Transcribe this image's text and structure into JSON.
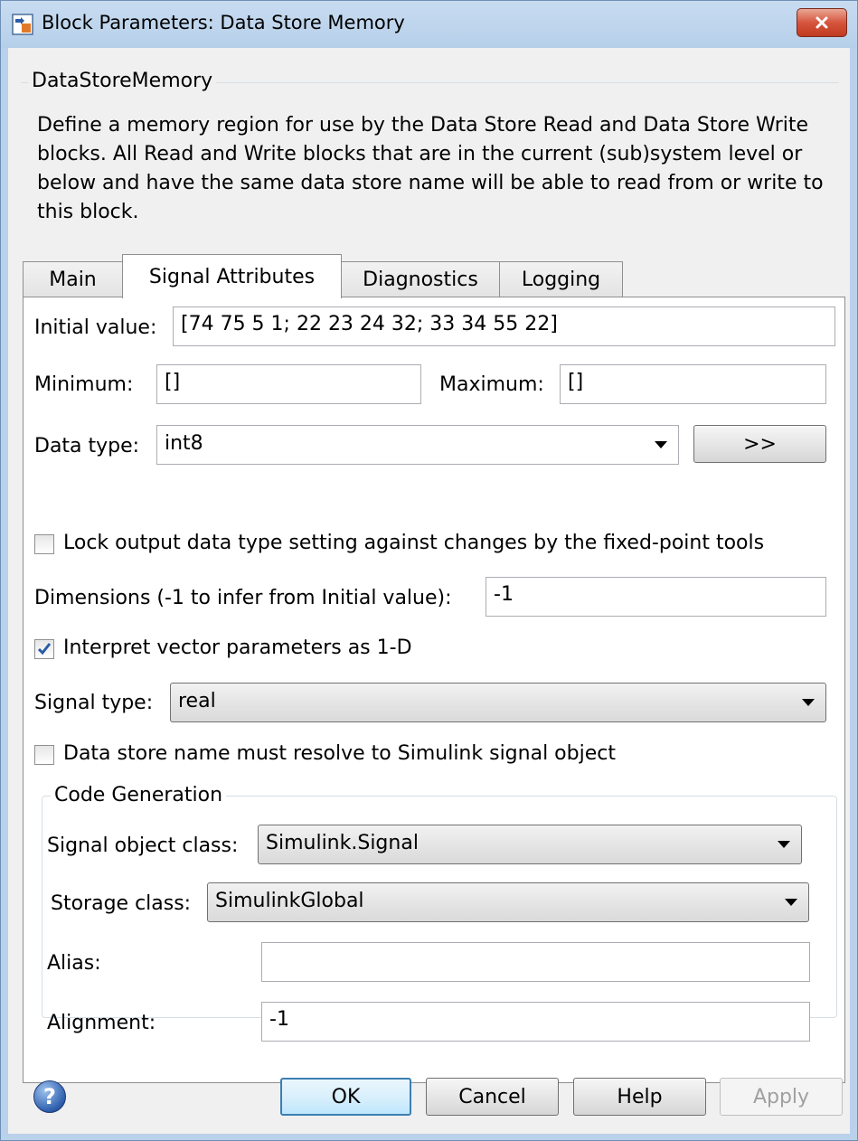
{
  "window": {
    "title": "Block Parameters: Data Store Memory"
  },
  "description": {
    "group_title": "DataStoreMemory",
    "text": "Define a memory region for use by the Data Store Read and Data Store Write blocks. All Read and Write blocks that are in the current (sub)system level or below and have the same data store name will be able to read from or write to this block."
  },
  "tabs": [
    {
      "label": "Main",
      "active": false
    },
    {
      "label": "Signal Attributes",
      "active": true
    },
    {
      "label": "Diagnostics",
      "active": false
    },
    {
      "label": "Logging",
      "active": false
    }
  ],
  "form": {
    "initial_value_label": "Initial value:",
    "initial_value": "[74 75 5 1; 22 23 24 32; 33 34 55 22]",
    "minimum_label": "Minimum:",
    "minimum_value": "[]",
    "maximum_label": "Maximum:",
    "maximum_value": "[]",
    "data_type_label": "Data type:",
    "data_type_value": "int8",
    "data_type_button": ">>",
    "lock_label": "Lock output data type setting against changes by the fixed-point tools",
    "lock_checked": false,
    "dimensions_label": "Dimensions (-1 to infer from Initial value):",
    "dimensions_value": "-1",
    "interpret_label": "Interpret vector parameters as 1-D",
    "interpret_checked": true,
    "signal_type_label": "Signal type:",
    "signal_type_value": "real",
    "resolve_label": "Data store name must resolve to Simulink signal object",
    "resolve_checked": false
  },
  "code_generation": {
    "group_title": "Code Generation",
    "signal_object_class_label": "Signal object class:",
    "signal_object_class_value": "Simulink.Signal",
    "storage_class_label": "Storage class:",
    "storage_class_value": "SimulinkGlobal",
    "alias_label": "Alias:",
    "alias_value": "",
    "alignment_label": "Alignment:",
    "alignment_value": "-1"
  },
  "buttons": {
    "help_icon": "?",
    "ok": "OK",
    "cancel": "Cancel",
    "help": "Help",
    "apply": "Apply"
  },
  "colors": {
    "titlebar": "#b9d1ea",
    "dialog_bg": "#f0f0f0",
    "close_red": "#c03a20",
    "check_blue": "#2a5ca8"
  }
}
